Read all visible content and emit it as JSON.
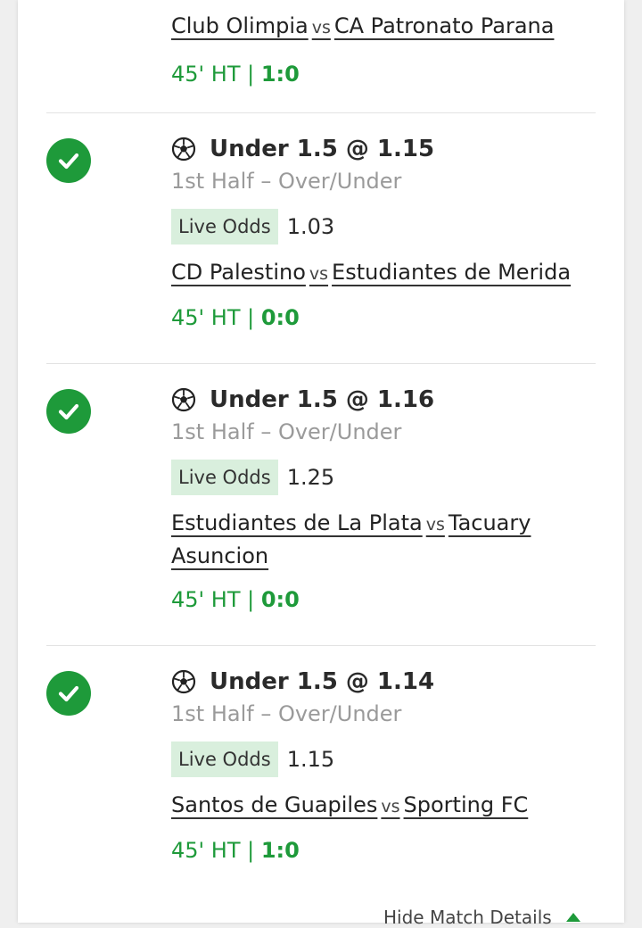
{
  "top": {
    "home": "Club Olimpia",
    "vs": "vs",
    "away": "CA Patronato Parana",
    "time": "45' HT",
    "sep": "|",
    "score": "1:0"
  },
  "bets": [
    {
      "selection": "Under 1.5 @ 1.15",
      "market": "1st Half – Over/Under",
      "live_label": "Live Odds",
      "live_value": "1.03",
      "home": "CD Palestino",
      "vs": "vs",
      "away": "Estudiantes de Merida",
      "time": "45' HT",
      "sep": "|",
      "score": "0:0"
    },
    {
      "selection": "Under 1.5 @ 1.16",
      "market": "1st Half – Over/Under",
      "live_label": "Live Odds",
      "live_value": "1.25",
      "home": "Estudiantes de La Plata",
      "vs": "vs",
      "away": "Tacuary Asuncion",
      "time": "45' HT",
      "sep": "|",
      "score": "0:0"
    },
    {
      "selection": "Under 1.5 @ 1.14",
      "market": "1st Half – Over/Under",
      "live_label": "Live Odds",
      "live_value": "1.15",
      "home": "Santos de Guapiles",
      "vs": "vs",
      "away": "Sporting FC",
      "time": "45' HT",
      "sep": "|",
      "score": "1:0"
    }
  ],
  "footer": {
    "hide_label": "Hide Match Details"
  },
  "colors": {
    "accent_green": "#1e9a3a",
    "badge_bg": "#d9efdd",
    "muted": "#9a9a9a"
  },
  "icons": {
    "status": "check-circle-icon",
    "sport": "soccer-ball-icon",
    "toggle": "chevron-up-icon"
  }
}
